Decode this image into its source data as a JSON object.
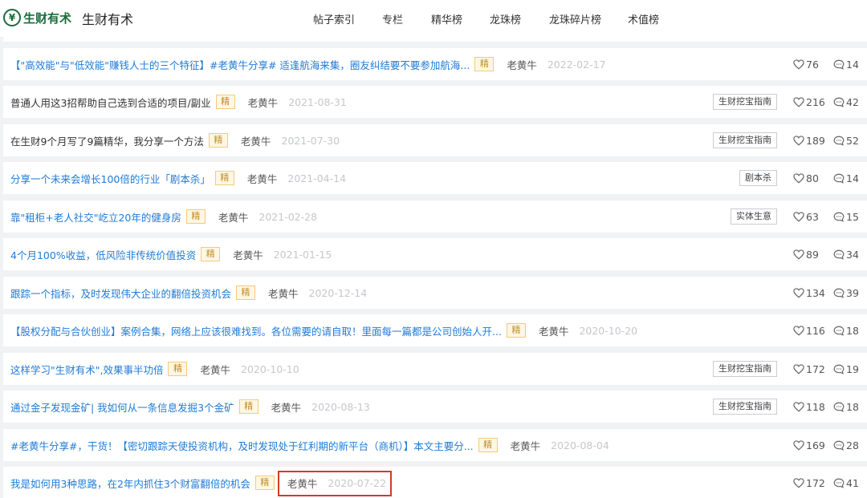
{
  "header": {
    "logo_text": "生财有术",
    "logo_glyph": "¥",
    "site_name": "生财有术",
    "nav": [
      "帖子索引",
      "专栏",
      "精华榜",
      "龙珠榜",
      "龙珠碎片榜",
      "术值榜"
    ]
  },
  "badge_label": "精",
  "posts": [
    {
      "title": "【\"高效能\"与\"低效能\"赚钱人士的三个特征】#老黄牛分享# 适逢航海来集，圈友纠结要不要参加航海...",
      "author": "老黄牛",
      "date": "2022-02-17",
      "tag": "",
      "likes": "76",
      "comments": "14",
      "link": true
    },
    {
      "title": "普通人用这3招帮助自己选到合适的项目/副业",
      "author": "老黄牛",
      "date": "2021-08-31",
      "tag": "生财挖宝指南",
      "likes": "216",
      "comments": "42",
      "link": false
    },
    {
      "title": "在生财9个月写了9篇精华，我分享一个方法",
      "author": "老黄牛",
      "date": "2021-07-30",
      "tag": "生财挖宝指南",
      "likes": "189",
      "comments": "52",
      "link": false
    },
    {
      "title": "分享一个未来会增长100倍的行业「剧本杀」",
      "author": "老黄牛",
      "date": "2021-04-14",
      "tag": "剧本杀",
      "likes": "80",
      "comments": "14",
      "link": true
    },
    {
      "title": "靠\"租柜+老人社交\"屹立20年的健身房",
      "author": "老黄牛",
      "date": "2021-02-28",
      "tag": "实体生意",
      "likes": "63",
      "comments": "15",
      "link": true
    },
    {
      "title": "4个月100%收益，低风险非传统价值投资",
      "author": "老黄牛",
      "date": "2021-01-15",
      "tag": "",
      "likes": "89",
      "comments": "34",
      "link": true
    },
    {
      "title": "跟踪一个指标，及时发现伟大企业的翻倍投资机会",
      "author": "老黄牛",
      "date": "2020-12-14",
      "tag": "",
      "likes": "134",
      "comments": "39",
      "link": true
    },
    {
      "title": "【股权分配与合伙创业】案例合集，网络上应该很难找到。各位需要的请自取！里面每一篇都是公司创始人开...",
      "author": "老黄牛",
      "date": "2020-10-20",
      "tag": "",
      "likes": "116",
      "comments": "18",
      "link": true
    },
    {
      "title": "这样学习\"生财有术\",效果事半功倍",
      "author": "老黄牛",
      "date": "2020-10-10",
      "tag": "生财挖宝指南",
      "likes": "172",
      "comments": "19",
      "link": true
    },
    {
      "title": "通过金子发现金矿| 我如何从一条信息发掘3个金矿",
      "author": "老黄牛",
      "date": "2020-08-13",
      "tag": "生财挖宝指南",
      "likes": "118",
      "comments": "18",
      "link": true
    },
    {
      "title": "#老黄牛分享#，干货！【密切跟踪天使投资机构，及时发现处于红利期的新平台（商机）】本文主要分...",
      "author": "老黄牛",
      "date": "2020-08-04",
      "tag": "",
      "likes": "169",
      "comments": "28",
      "link": true
    },
    {
      "title": "我是如何用3种思路，在2年内抓住3个财富翻倍的机会",
      "author": "老黄牛",
      "date": "2020-07-22",
      "tag": "",
      "likes": "172",
      "comments": "41",
      "link": true
    }
  ],
  "colors": {
    "brand": "#1b6b3c",
    "link": "#1f7bd6",
    "highlight": "#d23a2c"
  }
}
